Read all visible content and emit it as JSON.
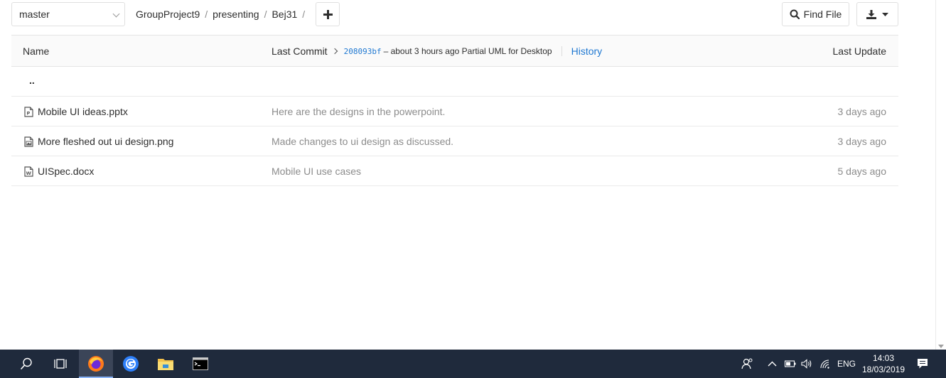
{
  "repo_nav": {
    "branch": "master",
    "breadcrumb": [
      "GroupProject9",
      "presenting",
      "Bej31"
    ],
    "add_label": "+",
    "find_file_label": "Find File"
  },
  "tree": {
    "headers": {
      "name": "Name",
      "last_commit": "Last Commit",
      "last_update": "Last Update"
    },
    "last_commit": {
      "sha": "208093bf",
      "message": "– about 3 hours ago Partial UML for Desktop",
      "history_label": "History"
    },
    "parent_dir": "..",
    "rows": [
      {
        "name": "Mobile UI ideas.pptx",
        "icon": "powerpoint-file-icon",
        "message": "Here are the designs in the powerpoint.",
        "date": "3 days ago"
      },
      {
        "name": "More fleshed out ui design.png",
        "icon": "image-file-icon",
        "message": "Made changes to ui design as discussed.",
        "date": "3 days ago"
      },
      {
        "name": "UISpec.docx",
        "icon": "word-file-icon",
        "message": "Mobile UI use cases",
        "date": "5 days ago"
      }
    ]
  },
  "taskbar": {
    "apps": [
      "search-icon",
      "task-view-icon",
      "firefox-icon",
      "google-icon",
      "file-explorer-icon",
      "command-prompt-icon"
    ],
    "active_app": "firefox-icon",
    "language": "ENG",
    "time": "14:03",
    "date": "18/03/2019"
  },
  "colors": {
    "link": "#1f78d1",
    "muted": "#8c8c8c",
    "taskbar": "#1f2a3c"
  }
}
